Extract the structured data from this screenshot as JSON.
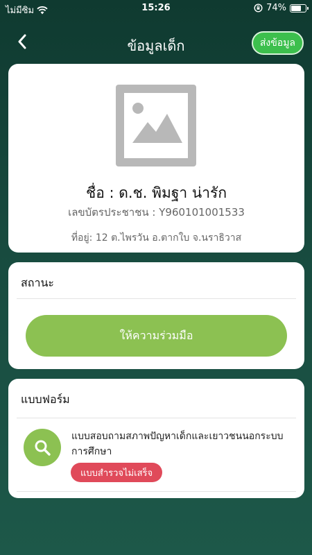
{
  "status_bar": {
    "carrier": "ไม่มีซิม",
    "time": "15:26",
    "battery": "74%",
    "battery_level": 0.74
  },
  "nav": {
    "title": "ข้อมูลเด็ก",
    "send_label": "ส่งข้อมูล",
    "back_icon": "chevron-left-icon"
  },
  "profile": {
    "photo_icon": "image-placeholder-icon",
    "name": "ชื่อ : ด.ช. พิมฐา น่ารัก",
    "id_card": "เลขบัตรประชาชน : Y960101001533",
    "address": "ที่อยู่: 12 ต.ไพรวัน อ.ตากใบ จ.นราธิวาส"
  },
  "status": {
    "heading": "สถานะ",
    "button_label": "ให้ความร่วมมือ"
  },
  "forms": {
    "heading": "แบบฟอร์ม",
    "items": [
      {
        "icon": "search-icon",
        "title": "แบบสอบถามสภาพปัญหาเด็กและเยาวชนนอกระบบการศึกษา",
        "badge": "แบบสำรวจไม่เสร็จ"
      }
    ]
  },
  "colors": {
    "background": "#184b3f",
    "accent_green": "#8cc152",
    "send_green": "#3cbf4d",
    "badge_red": "#e04a5a"
  }
}
